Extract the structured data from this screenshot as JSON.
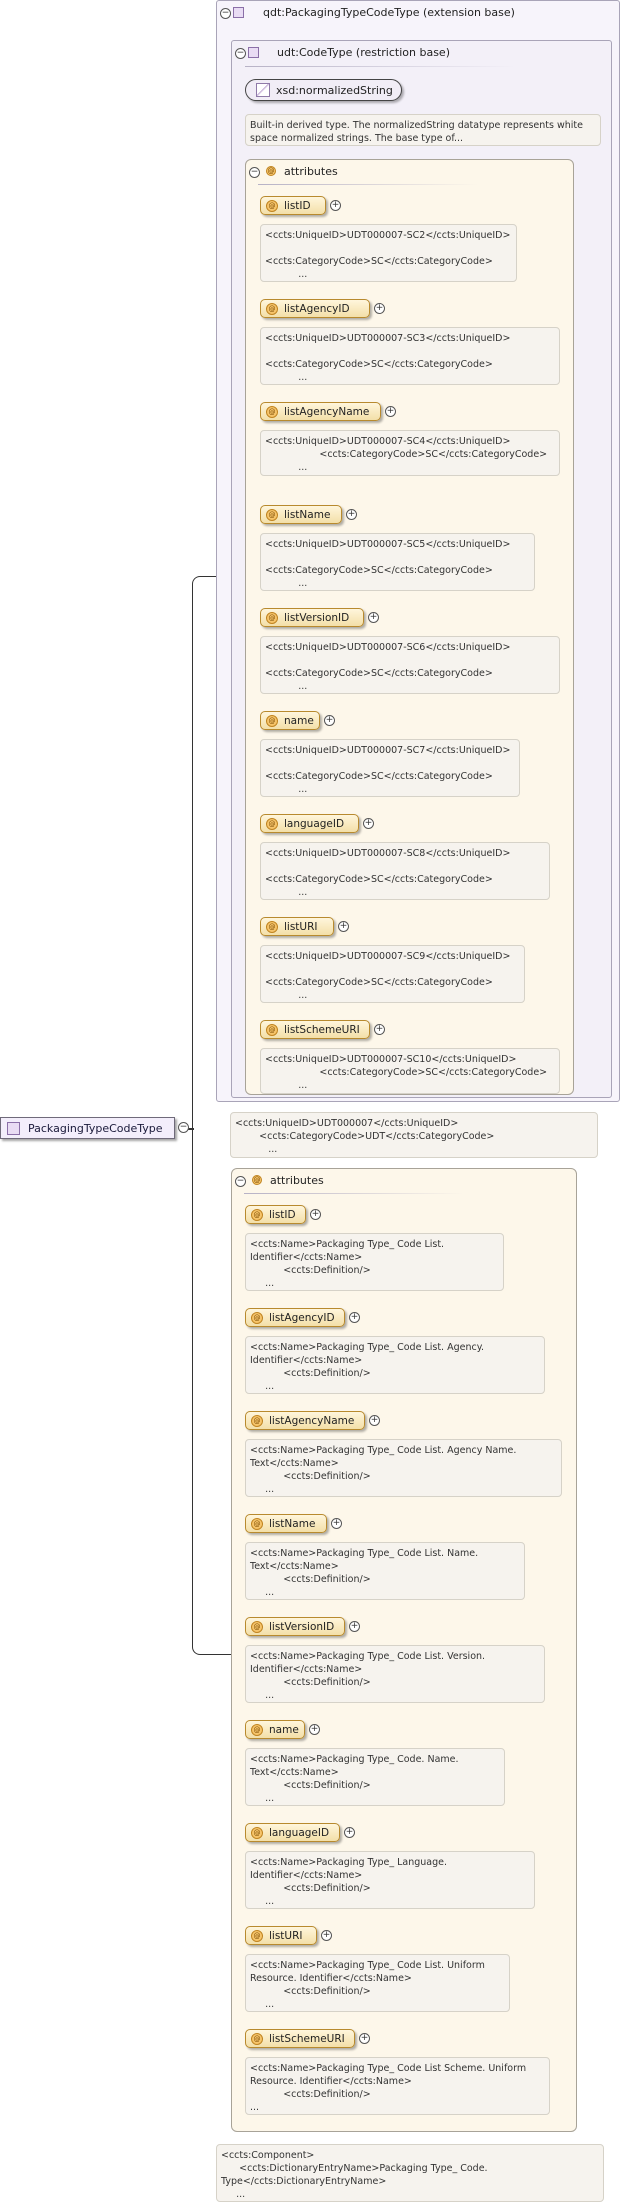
{
  "root": {
    "label": "PackagingTypeCodeType"
  },
  "extension": {
    "title": "qdt:PackagingTypeCodeType (extension base)"
  },
  "restriction": {
    "title": "udt:CodeType (restriction base)"
  },
  "simple_type": {
    "label": "xsd:normalizedString",
    "doc": "Built-in derived type. The normalizedString datatype represents white space normalized strings. The base type of..."
  },
  "inner_attributes": {
    "title": "attributes",
    "items": [
      {
        "name": "listID",
        "doc": "<ccts:UniqueID>UDT000007-SC2</ccts:UniqueID>\n\n<ccts:CategoryCode>SC</ccts:CategoryCode>\n           ..."
      },
      {
        "name": "listAgencyID",
        "doc": "<ccts:UniqueID>UDT000007-SC3</ccts:UniqueID>\n\n<ccts:CategoryCode>SC</ccts:CategoryCode>\n           ..."
      },
      {
        "name": "listAgencyName",
        "doc": "<ccts:UniqueID>UDT000007-SC4</ccts:UniqueID>\n                  <ccts:CategoryCode>SC</ccts:CategoryCode>\n           ..."
      },
      {
        "name": "listName",
        "doc": "<ccts:UniqueID>UDT000007-SC5</ccts:UniqueID>\n\n<ccts:CategoryCode>SC</ccts:CategoryCode>\n           ..."
      },
      {
        "name": "listVersionID",
        "doc": "<ccts:UniqueID>UDT000007-SC6</ccts:UniqueID>\n\n<ccts:CategoryCode>SC</ccts:CategoryCode>\n           ..."
      },
      {
        "name": "name",
        "doc": "<ccts:UniqueID>UDT000007-SC7</ccts:UniqueID>\n\n<ccts:CategoryCode>SC</ccts:CategoryCode>\n           ..."
      },
      {
        "name": "languageID",
        "doc": "<ccts:UniqueID>UDT000007-SC8</ccts:UniqueID>\n\n<ccts:CategoryCode>SC</ccts:CategoryCode>\n           ..."
      },
      {
        "name": "listURI",
        "doc": "<ccts:UniqueID>UDT000007-SC9</ccts:UniqueID>\n\n<ccts:CategoryCode>SC</ccts:CategoryCode>\n           ..."
      },
      {
        "name": "listSchemeURI",
        "doc": "<ccts:UniqueID>UDT000007-SC10</ccts:UniqueID>\n                  <ccts:CategoryCode>SC</ccts:CategoryCode>\n           ..."
      }
    ]
  },
  "extension_doc": "<ccts:UniqueID>UDT000007</ccts:UniqueID>\n        <ccts:CategoryCode>UDT</ccts:CategoryCode>\n           ...",
  "outer_attributes": {
    "title": "attributes",
    "items": [
      {
        "name": "listID",
        "doc": "<ccts:Name>Packaging Type_ Code List.\nIdentifier</ccts:Name>\n           <ccts:Definition/>\n     ..."
      },
      {
        "name": "listAgencyID",
        "doc": "<ccts:Name>Packaging Type_ Code List. Agency.\nIdentifier</ccts:Name>\n           <ccts:Definition/>\n     ..."
      },
      {
        "name": "listAgencyName",
        "doc": "<ccts:Name>Packaging Type_ Code List. Agency Name.\nText</ccts:Name>\n           <ccts:Definition/>\n     ..."
      },
      {
        "name": "listName",
        "doc": "<ccts:Name>Packaging Type_ Code List. Name.\nText</ccts:Name>\n           <ccts:Definition/>\n     ..."
      },
      {
        "name": "listVersionID",
        "doc": "<ccts:Name>Packaging Type_ Code List. Version.\nIdentifier</ccts:Name>\n           <ccts:Definition/>\n     ..."
      },
      {
        "name": "name",
        "doc": "<ccts:Name>Packaging Type_ Code. Name.\nText</ccts:Name>\n           <ccts:Definition/>\n     ..."
      },
      {
        "name": "languageID",
        "doc": "<ccts:Name>Packaging Type_ Language.\nIdentifier</ccts:Name>\n           <ccts:Definition/>\n     ..."
      },
      {
        "name": "listURI",
        "doc": "<ccts:Name>Packaging Type_ Code List. Uniform\nResource. Identifier</ccts:Name>\n           <ccts:Definition/>\n     ..."
      },
      {
        "name": "listSchemeURI",
        "doc": "<ccts:Name>Packaging Type_ Code List Scheme. Uniform\nResource. Identifier</ccts:Name>\n           <ccts:Definition/>\n..."
      }
    ]
  },
  "root_doc": "<ccts:Component>\n      <ccts:DictionaryEntryName>Packaging Type_ Code.\nType</ccts:DictionaryEntryName>\n     ..."
}
